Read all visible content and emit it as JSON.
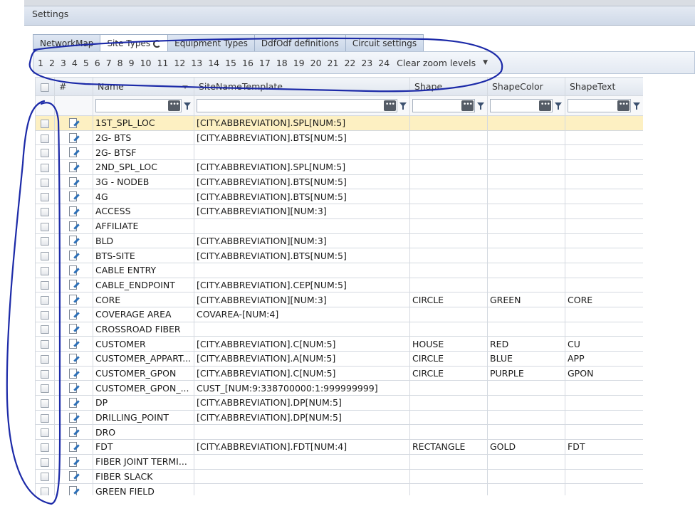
{
  "header": {
    "title": "Settings"
  },
  "tabs": [
    {
      "label": "NetworkMap",
      "active": false
    },
    {
      "label": "Site Types",
      "active": true
    },
    {
      "label": "Equipment Types",
      "active": false
    },
    {
      "label": "DdfOdf definitions",
      "active": false
    },
    {
      "label": "Circuit settings",
      "active": false
    }
  ],
  "zoom": {
    "levels": [
      "1",
      "2",
      "3",
      "4",
      "5",
      "6",
      "7",
      "8",
      "9",
      "10",
      "11",
      "12",
      "13",
      "14",
      "15",
      "16",
      "17",
      "18",
      "19",
      "20",
      "21",
      "22",
      "23",
      "24"
    ],
    "clear_label": "Clear zoom levels"
  },
  "grid": {
    "columns": [
      "#",
      "Name",
      "SiteNameTemplate",
      "Shape",
      "ShapeColor",
      "ShapeText"
    ],
    "filter_button": "•••",
    "rows": [
      {
        "name": "1ST_SPL_LOC",
        "template": "[CITY.ABBREVIATION].SPL[NUM:5]",
        "shape": "",
        "color": "",
        "text": "",
        "selected": true
      },
      {
        "name": "2G- BTS",
        "template": "[CITY.ABBREVIATION].BTS[NUM:5]",
        "shape": "",
        "color": "",
        "text": ""
      },
      {
        "name": "2G- BTSF",
        "template": "",
        "shape": "",
        "color": "",
        "text": ""
      },
      {
        "name": "2ND_SPL_LOC",
        "template": "[CITY.ABBREVIATION].SPL[NUM:5]",
        "shape": "",
        "color": "",
        "text": ""
      },
      {
        "name": "3G - NODEB",
        "template": "[CITY.ABBREVIATION].BTS[NUM:5]",
        "shape": "",
        "color": "",
        "text": ""
      },
      {
        "name": "4G",
        "template": "[CITY.ABBREVIATION].BTS[NUM:5]",
        "shape": "",
        "color": "",
        "text": ""
      },
      {
        "name": "ACCESS",
        "template": "[CITY.ABBREVIATION][NUM:3]",
        "shape": "",
        "color": "",
        "text": ""
      },
      {
        "name": "AFFILIATE",
        "template": "",
        "shape": "",
        "color": "",
        "text": ""
      },
      {
        "name": "BLD",
        "template": "[CITY.ABBREVIATION][NUM:3]",
        "shape": "",
        "color": "",
        "text": ""
      },
      {
        "name": "BTS-SITE",
        "template": "[CITY.ABBREVIATION].BTS[NUM:5]",
        "shape": "",
        "color": "",
        "text": ""
      },
      {
        "name": "CABLE ENTRY",
        "template": "",
        "shape": "",
        "color": "",
        "text": ""
      },
      {
        "name": "CABLE_ENDPOINT",
        "template": "[CITY.ABBREVIATION].CEP[NUM:5]",
        "shape": "",
        "color": "",
        "text": ""
      },
      {
        "name": "CORE",
        "template": "[CITY.ABBREVIATION][NUM:3]",
        "shape": "CIRCLE",
        "color": "GREEN",
        "text": "CORE"
      },
      {
        "name": "COVERAGE AREA",
        "template": "COVAREA-[NUM:4]",
        "shape": "",
        "color": "",
        "text": ""
      },
      {
        "name": "CROSSROAD FIBER",
        "template": "",
        "shape": "",
        "color": "",
        "text": ""
      },
      {
        "name": "CUSTOMER",
        "template": "[CITY.ABBREVIATION].C[NUM:5]",
        "shape": "HOUSE",
        "color": "RED",
        "text": "CU"
      },
      {
        "name": "CUSTOMER_APPART...",
        "template": "[CITY.ABBREVIATION].A[NUM:5]",
        "shape": "CIRCLE",
        "color": "BLUE",
        "text": "APP"
      },
      {
        "name": "CUSTOMER_GPON",
        "template": "[CITY.ABBREVIATION].C[NUM:5]",
        "shape": "CIRCLE",
        "color": "PURPLE",
        "text": "GPON"
      },
      {
        "name": "CUSTOMER_GPON_...",
        "template": "CUST_[NUM:9:338700000:1:999999999]",
        "shape": "",
        "color": "",
        "text": ""
      },
      {
        "name": "DP",
        "template": "[CITY.ABBREVIATION].DP[NUM:5]",
        "shape": "",
        "color": "",
        "text": ""
      },
      {
        "name": "DRILLING_POINT",
        "template": "[CITY.ABBREVIATION].DP[NUM:5]",
        "shape": "",
        "color": "",
        "text": ""
      },
      {
        "name": "DRO",
        "template": "",
        "shape": "",
        "color": "",
        "text": ""
      },
      {
        "name": "FDT",
        "template": "[CITY.ABBREVIATION].FDT[NUM:4]",
        "shape": "RECTANGLE",
        "color": "GOLD",
        "text": "FDT"
      },
      {
        "name": "FIBER JOINT TERMI...",
        "template": "",
        "shape": "",
        "color": "",
        "text": ""
      },
      {
        "name": "FIBER SLACK",
        "template": "",
        "shape": "",
        "color": "",
        "text": ""
      },
      {
        "name": "GREEN FIELD",
        "template": "",
        "shape": "",
        "color": "",
        "text": ""
      }
    ]
  },
  "colors": {
    "annotation_ink": "#1c2aa8",
    "selected_row": "#fdf0c2"
  }
}
